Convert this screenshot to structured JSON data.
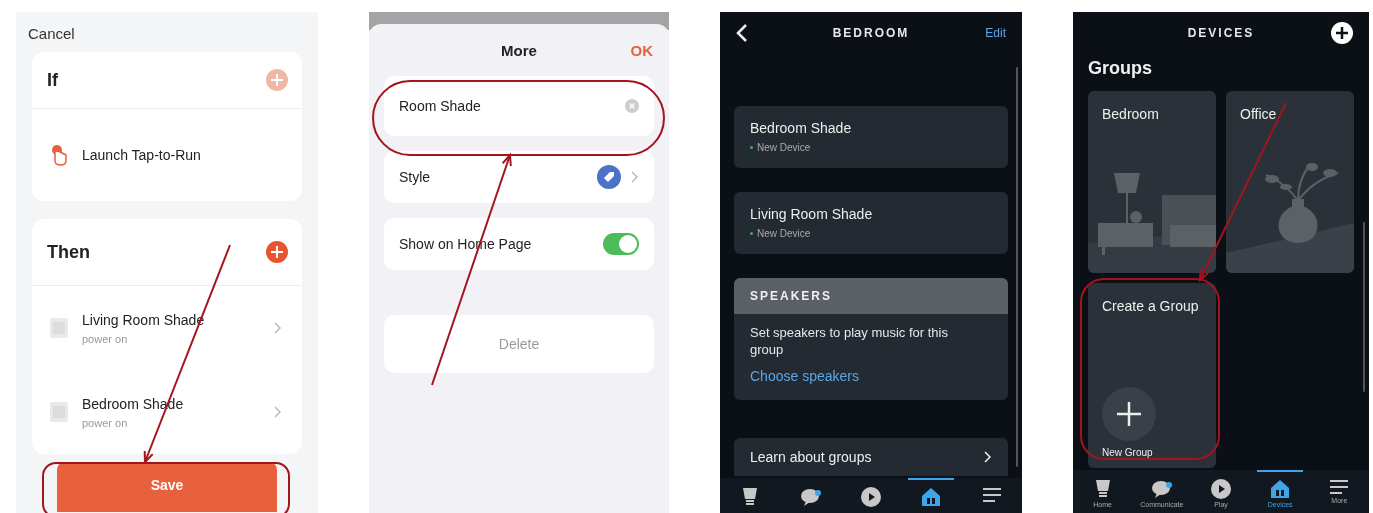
{
  "routine_screen": {
    "cancel": "Cancel",
    "sections": [
      {
        "title": "If",
        "add_disabled": true,
        "items": [
          {
            "kind": "trigger",
            "label": "Launch Tap-to-Run"
          }
        ]
      },
      {
        "title": "Then",
        "add_disabled": false,
        "items": [
          {
            "kind": "device",
            "label": "Living Room Shade",
            "status": "power on"
          },
          {
            "kind": "device",
            "label": "Bedroom Shade",
            "status": "power on"
          }
        ]
      }
    ],
    "save_button": {
      "label": "Save",
      "highlighted": true
    }
  },
  "more_sheet": {
    "title": "More",
    "ok": "OK",
    "name_field": {
      "value": "Room Shade",
      "highlighted": true
    },
    "rows": [
      {
        "kind": "style",
        "label": "Style"
      },
      {
        "kind": "toggle",
        "label": "Show on Home Page",
        "on": true
      }
    ],
    "delete": "Delete"
  },
  "group_screen": {
    "title": "BEDROOM",
    "edit": "Edit",
    "devices": [
      {
        "name": "Bedroom Shade",
        "status": "New Device",
        "color": "#3fae5a"
      },
      {
        "name": "Living Room Shade",
        "status": "New Device",
        "color": "#3fae5a"
      }
    ],
    "speakers": {
      "header": "SPEAKERS",
      "text": "Set speakers to play music for this group",
      "link": "Choose speakers"
    },
    "learn": "Learn about groups",
    "nav": [
      {
        "kind": "home",
        "selected": false
      },
      {
        "kind": "communicate",
        "selected": false
      },
      {
        "kind": "play",
        "selected": false
      },
      {
        "kind": "devices",
        "selected": true
      },
      {
        "kind": "more",
        "selected": false
      }
    ]
  },
  "devices_screen": {
    "title": "DEVICES",
    "heading": "Groups",
    "groups": [
      {
        "kind": "bedroom",
        "name": "Bedroom"
      },
      {
        "kind": "office",
        "name": "Office"
      }
    ],
    "create": {
      "title": "Create a Group",
      "button": "New Group",
      "highlighted": true
    },
    "nav": [
      {
        "kind": "home",
        "label": "Home",
        "selected": false
      },
      {
        "kind": "communicate",
        "label": "Communicate",
        "selected": false
      },
      {
        "kind": "play",
        "label": "Play",
        "selected": false
      },
      {
        "kind": "devices",
        "label": "Devices",
        "selected": true
      },
      {
        "kind": "more",
        "label": "More",
        "selected": false
      }
    ]
  }
}
